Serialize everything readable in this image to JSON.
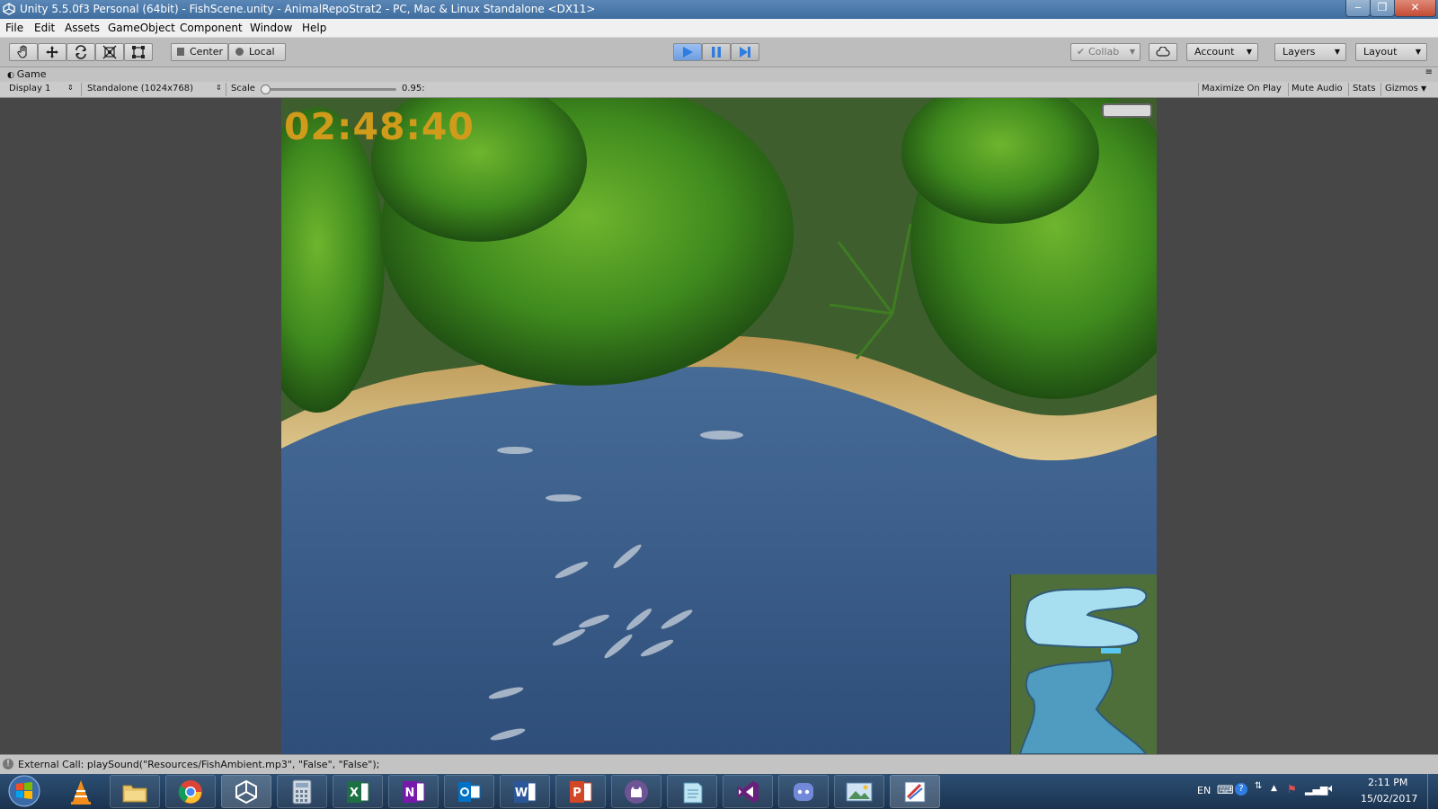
{
  "window": {
    "title": "Unity 5.5.0f3 Personal (64bit) - FishScene.unity - AnimalRepoStrat2 - PC, Mac & Linux Standalone <DX11>",
    "minimize": "‒",
    "restore": "❐",
    "close": "✕"
  },
  "menu": {
    "items": [
      "File",
      "Edit",
      "Assets",
      "GameObject",
      "Component",
      "Window",
      "Help"
    ]
  },
  "toolbar": {
    "pivot_label": "Center",
    "space_label": "Local",
    "collab_label": "Collab",
    "account_label": "Account",
    "layers_label": "Layers",
    "layout_label": "Layout"
  },
  "game_panel": {
    "tab_label": "Game",
    "display_label": "Display 1",
    "resolution_label": "Standalone (1024x768)",
    "scale_label": "Scale",
    "scale_value": "0.95:",
    "scale_slider_fraction": 0.02,
    "maximize_label": "Maximize On Play",
    "mute_label": "Mute Audio",
    "stats_label": "Stats",
    "gizmos_label": "Gizmos"
  },
  "game": {
    "timer": "02:48:40"
  },
  "console": {
    "message": "External Call: playSound(\"Resources/FishAmbient.mp3\", \"False\", \"False\");"
  },
  "taskbar": {
    "apps": [
      "start-orb",
      "vlc",
      "file-explorer",
      "chrome",
      "unity",
      "calculator",
      "excel",
      "onenote",
      "outlook",
      "word",
      "powerpoint",
      "github-desktop",
      "notepad",
      "visual-studio",
      "discord",
      "photo-viewer",
      "paint"
    ],
    "language": "EN",
    "time": "2:11 PM",
    "date": "15/02/2017"
  },
  "colors": {
    "title_bar": "#3f6d9e",
    "timer": "#d09b1a",
    "play_blue": "#2f7de0",
    "water": "#3a5a8a"
  }
}
